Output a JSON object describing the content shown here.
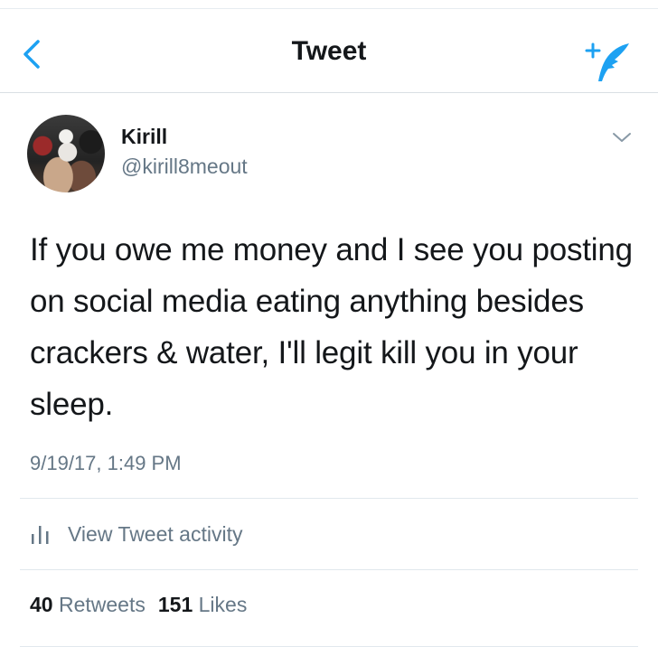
{
  "header": {
    "title": "Tweet",
    "back_icon": "chevron-left-icon",
    "compose_icon": "compose-tweet-icon"
  },
  "tweet": {
    "author_name": "Kirill",
    "author_handle": "@kirill8meout",
    "text": "If you owe me money and I see you posting on social media eating anything besides crackers & water, I'll legit kill you in your sleep.",
    "timestamp": "9/19/17, 1:49 PM"
  },
  "activity": {
    "label": "View Tweet activity",
    "icon": "bar-chart-icon"
  },
  "stats": {
    "retweets_count": "40",
    "retweets_label": "Retweets",
    "likes_count": "151",
    "likes_label": "Likes"
  },
  "colors": {
    "accent": "#1da1f2",
    "secondary_text": "#657786",
    "primary_text": "#14171a"
  }
}
